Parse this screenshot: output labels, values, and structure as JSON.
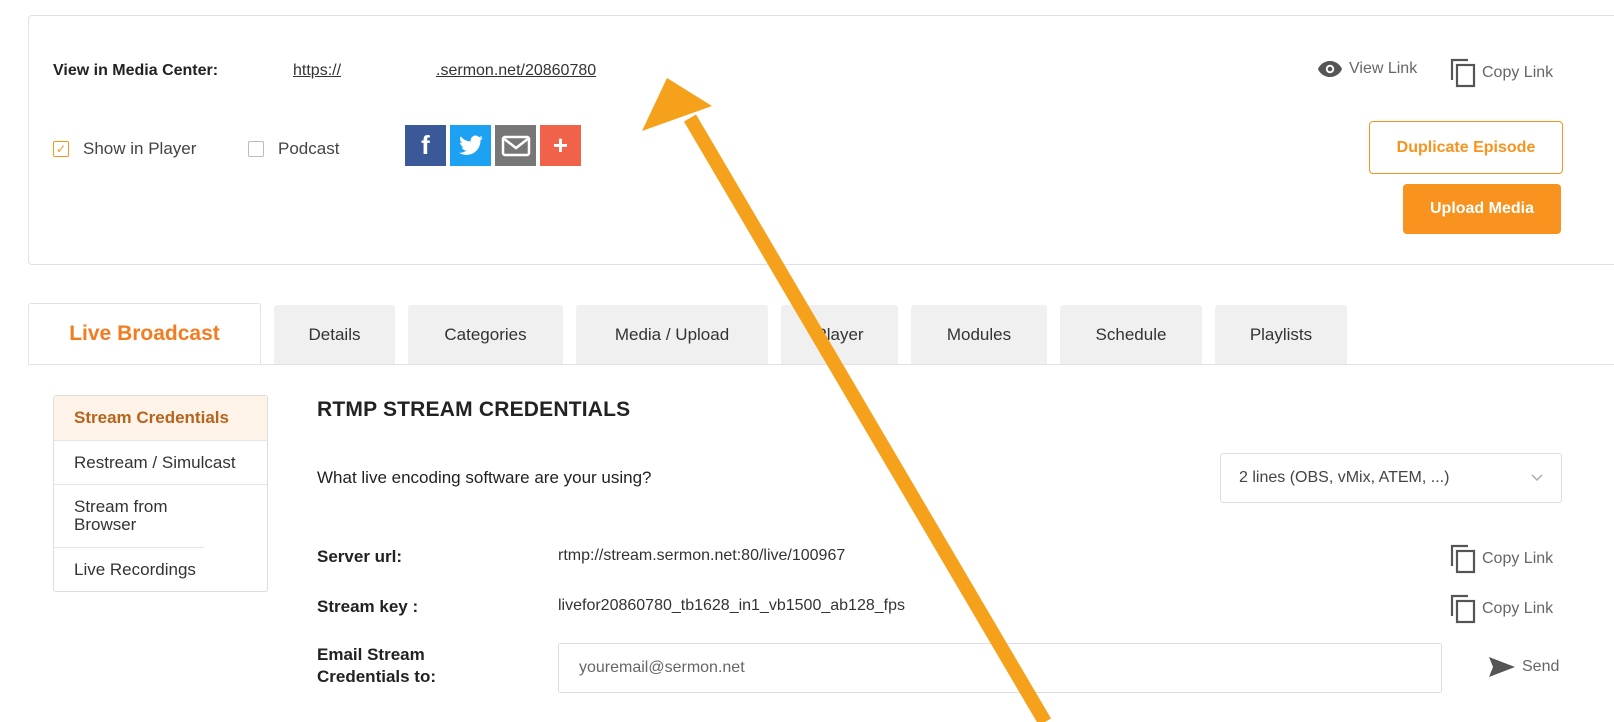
{
  "media_center": {
    "label": "View in Media Center:",
    "url_prefix": "https://",
    "url_suffix": ".sermon.net/20860780",
    "view_link": "View Link",
    "copy_link": "Copy Link"
  },
  "options": {
    "show_in_player": "Show in Player",
    "show_in_player_checked": true,
    "podcast": "Podcast",
    "podcast_checked": false
  },
  "social": [
    {
      "icon": "facebook-icon",
      "glyph": "f",
      "color": "#3b5998"
    },
    {
      "icon": "twitter-icon",
      "glyph": "t",
      "color": "#1da1f2"
    },
    {
      "icon": "email-icon",
      "glyph": "✉",
      "color": "#777777"
    },
    {
      "icon": "share-plus-icon",
      "glyph": "+",
      "color": "#f0624a"
    }
  ],
  "buttons": {
    "duplicate": "Duplicate Episode",
    "upload": "Upload Media"
  },
  "tabs": [
    {
      "label": "Live Broadcast",
      "active": true
    },
    {
      "label": "Details"
    },
    {
      "label": "Categories"
    },
    {
      "label": "Media / Upload"
    },
    {
      "label": "Player"
    },
    {
      "label": "Modules"
    },
    {
      "label": "Schedule"
    },
    {
      "label": "Playlists"
    }
  ],
  "sidebar": {
    "items": [
      {
        "label": "Stream Credentials",
        "active": true
      },
      {
        "label": "Restream / Simulcast"
      },
      {
        "label": "Stream from Browser"
      },
      {
        "label": "Live Recordings"
      }
    ]
  },
  "rtmp": {
    "title": "RTMP STREAM CREDENTIALS",
    "question": "What live encoding software are your using?",
    "software_selected": "2 lines (OBS, vMix, ATEM, ...)",
    "server_label": "Server url:",
    "server_value": "rtmp://stream.sermon.net:80/live/100967",
    "key_label": "Stream key :",
    "key_value": "livefor20860780_tb1628_in1_vb1500_ab128_fps",
    "copy_link": "Copy Link",
    "email_label": "Email Stream Credentials to:",
    "email_placeholder": "youremail@sermon.net",
    "send": "Send"
  },
  "colors": {
    "accent": "#f7931e",
    "arrow": "#f5a11c"
  }
}
